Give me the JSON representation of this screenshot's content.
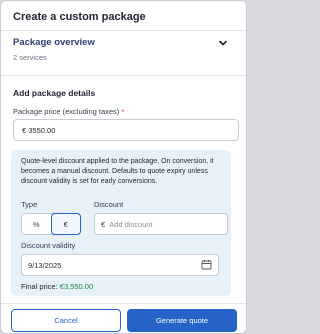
{
  "modal": {
    "title": "Create a custom package"
  },
  "overview": {
    "title": "Package overview",
    "subtitle": "2 services",
    "icon": "chevron-down-icon"
  },
  "details": {
    "section_title": "Add package details",
    "price_label": "Package price (excluding taxes)",
    "required_mark": "*",
    "price_value": "€ 3550.00"
  },
  "discount": {
    "note": "Quote-level discount applied to the package. On conversion, it becomes a manual discount. Defaults to quote expiry unless discount validity is set for early conversions.",
    "type_label": "Type",
    "type_options": [
      "%",
      "€"
    ],
    "type_selected": "€",
    "discount_label": "Discount",
    "currency_symbol": "€",
    "discount_placeholder": "Add discount",
    "validity_label": "Discount validity",
    "validity_value": "9/13/2025",
    "final_price_label": "Final price:",
    "final_price_value": "€3,550.00"
  },
  "footer": {
    "cancel_label": "Cancel",
    "generate_label": "Generate quote"
  },
  "colors": {
    "accent": "#2563c9",
    "discount_bg": "#e6f1fa",
    "final_price": "#1e8a4a",
    "overview_title": "#2c3e75"
  }
}
